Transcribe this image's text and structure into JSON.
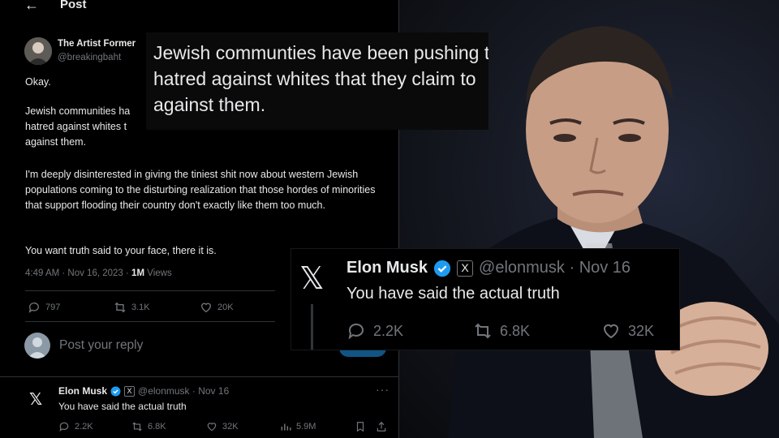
{
  "header": {
    "back_icon": "←",
    "title": "Post"
  },
  "tweet": {
    "author_name": "The Artist Former",
    "author_handle": "@breakingbaht",
    "line_okay": "Okay.",
    "line_para1_a": "Jewish communities ha",
    "line_para1_b": "hatred against whites t",
    "line_para1_c": "against them.",
    "paragraph_2": "I'm deeply disinterested in giving the tiniest shit now about western Jewish populations coming to the disturbing realization that those hordes of minorities that support flooding their country don't exactly like them too much.",
    "paragraph_3": "You want truth said to your face, there it is.",
    "timestamp": "4:49 AM · Nov 16, 2023 · ",
    "views_count": "1M",
    "views_label": " Views",
    "stats": {
      "replies": "797",
      "reposts": "3.1K",
      "likes": "20K"
    }
  },
  "reply_box": {
    "placeholder": "Post your reply"
  },
  "reply_tweet": {
    "logo": "𝕏",
    "name": "Elon Musk",
    "x_badge": "X",
    "handle": "@elonmusk · Nov 16",
    "text": "You have said the actual truth",
    "more": "···",
    "stats": {
      "replies": "2.2K",
      "reposts": "6.8K",
      "likes": "32K",
      "views": "5.9M"
    }
  },
  "zoom_overlay_1": {
    "line1": "Jewish communties have been pushing t",
    "line2": "hatred against whites that they claim to",
    "line3": "against them."
  },
  "zoom_overlay_2": {
    "logo": "𝕏",
    "name": "Elon Musk",
    "x_badge": "X",
    "handle": "@elonmusk · Nov 16",
    "text": "You have said the actual truth",
    "stats": {
      "replies": "2.2K",
      "reposts": "6.8K",
      "likes": "32K"
    }
  },
  "colors": {
    "background": "#000000",
    "text_primary": "#e7e9ea",
    "text_secondary": "#71767b",
    "verified_blue": "#1d9bf0",
    "divider": "#2f3336"
  },
  "icons": [
    "back-arrow-icon",
    "reply-icon",
    "repost-icon",
    "like-icon",
    "views-icon",
    "bookmark-icon",
    "share-icon",
    "verified-icon",
    "x-logo-icon",
    "more-icon"
  ]
}
